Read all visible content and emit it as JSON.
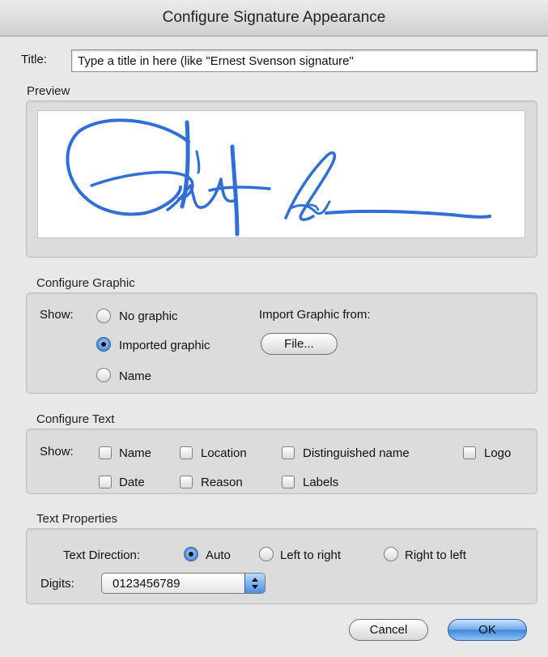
{
  "window": {
    "title": "Configure Signature Appearance"
  },
  "title_field": {
    "label": "Title:",
    "value": "Type a title in here (like \"Ernest Svenson signature\""
  },
  "preview": {
    "label": "Preview"
  },
  "configure_graphic": {
    "label": "Configure Graphic",
    "show_label": "Show:",
    "options": [
      "No graphic",
      "Imported graphic",
      "Name"
    ],
    "selected": "Imported graphic",
    "import_label": "Import Graphic from:",
    "file_button": "File..."
  },
  "configure_text": {
    "label": "Configure Text",
    "show_label": "Show:",
    "checkboxes": [
      "Name",
      "Location",
      "Distinguished name",
      "Logo",
      "Date",
      "Reason",
      "Labels"
    ]
  },
  "text_properties": {
    "label": "Text Properties",
    "direction_label": "Text Direction:",
    "directions": [
      "Auto",
      "Left to right",
      "Right to left"
    ],
    "selected_direction": "Auto",
    "digits_label": "Digits:",
    "digits_value": "0123456789"
  },
  "buttons": {
    "cancel": "Cancel",
    "ok": "OK"
  },
  "icons": {
    "select_stepper": "up-down-arrows-icon"
  },
  "colors": {
    "signature_ink": "#2f6fd6",
    "default_button": "#5b9ae6"
  }
}
